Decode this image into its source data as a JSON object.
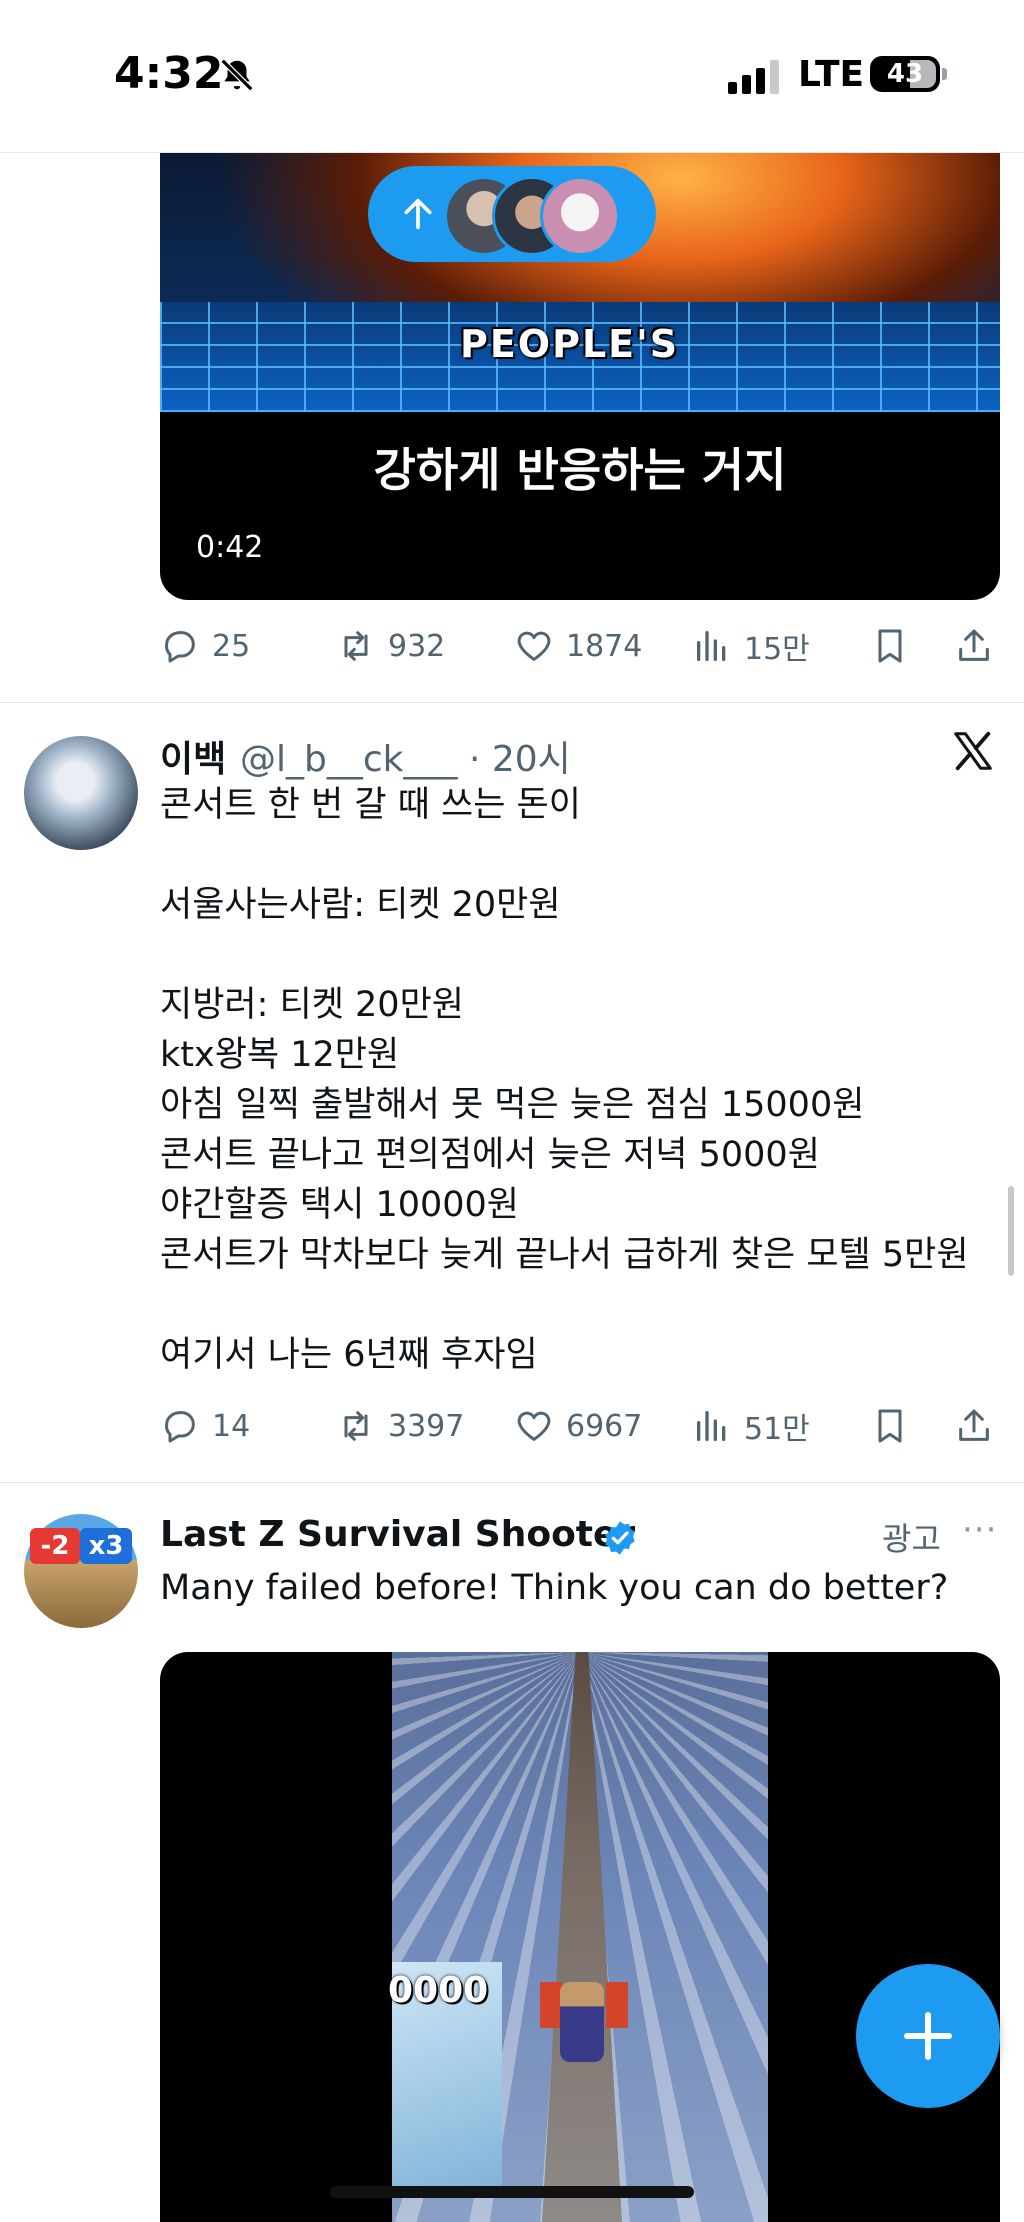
{
  "status_bar": {
    "time": "4:32",
    "network": "LTE",
    "battery": "43"
  },
  "feed": {
    "video_tweet": {
      "overlay_word": "PEOPLE'S",
      "caption": "강하게 반응하는 거지",
      "duration": "0:42",
      "new_posts_pill": {
        "arrow": "↑",
        "avatar_count": 3
      },
      "actions": {
        "replies": "25",
        "reposts": "932",
        "likes": "1874",
        "views": "15만"
      }
    },
    "tweet": {
      "name": "이백",
      "handle": "@l_b__ck___ · 20시",
      "text": "콘서트 한 번 갈 때 쓰는 돈이\n\n서울사는사람: 티켓 20만원\n\n지방러: 티켓 20만원\nktx왕복 12만원\n아침 일찍 출발해서 못 먹은 늦은 점심 15000원\n콘서트 끝나고 편의점에서 늦은 저녁 5000원\n야간할증 택시 10000원\n콘서트가 막차보다 늦게 끝나서 급하게 찾은 모텔 5만원\n\n여기서 나는 6년째 후자임",
      "actions": {
        "replies": "14",
        "reposts": "3397",
        "likes": "6967",
        "views": "51만"
      }
    },
    "ad_tweet": {
      "name": "Last Z Survival Shooter",
      "verified": true,
      "ad_label": "광고",
      "more": "···",
      "text": "Many failed before! Think you can do better?",
      "avatar_badges": [
        "-2",
        "x3"
      ],
      "video_score": "0000"
    }
  },
  "fab": {
    "icon": "plus-icon"
  },
  "colors": {
    "accent": "#1d9bf0",
    "secondary_text": "#536471",
    "primary_text": "#0f1419"
  }
}
